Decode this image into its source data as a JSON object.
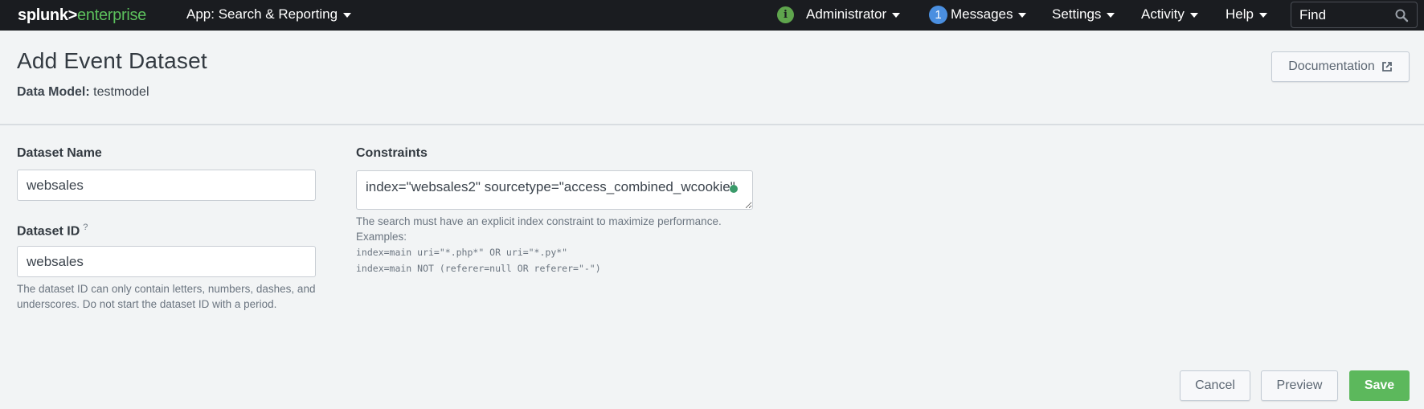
{
  "topbar": {
    "logo_primary": "splunk>",
    "logo_secondary": "enterprise",
    "app_menu": "App: Search & Reporting",
    "status_icon_glyph": "i",
    "user_menu": "Administrator",
    "messages_count": "1",
    "messages_menu": "Messages",
    "settings_menu": "Settings",
    "activity_menu": "Activity",
    "help_menu": "Help",
    "find_placeholder": "Find"
  },
  "header": {
    "title": "Add Event Dataset",
    "data_model_label": "Data Model:",
    "data_model_value": "testmodel",
    "documentation_button": "Documentation"
  },
  "form": {
    "dataset_name": {
      "label": "Dataset Name",
      "value": "websales"
    },
    "dataset_id": {
      "label": "Dataset ID",
      "help_marker": "?",
      "value": "websales",
      "help_text": "The dataset ID can only contain letters, numbers, dashes, and underscores. Do not start the dataset ID with a period."
    },
    "constraints": {
      "label": "Constraints",
      "value": "index=\"websales2\" sourcetype=\"access_combined_wcookie\"",
      "help_text": "The search must have an explicit index constraint to maximize performance.",
      "examples_label": "Examples:",
      "examples": [
        "index=main uri=\"*.php*\" OR uri=\"*.py*\"",
        "index=main NOT (referer=null OR referer=\"-\")"
      ]
    }
  },
  "actions": {
    "cancel": "Cancel",
    "preview": "Preview",
    "save": "Save"
  },
  "colors": {
    "topbar_bg": "#1a1c20",
    "brand_green": "#5cc05c",
    "primary_button": "#5cb85c",
    "message_badge": "#4a8fe0",
    "status_green": "#5fa54d"
  }
}
